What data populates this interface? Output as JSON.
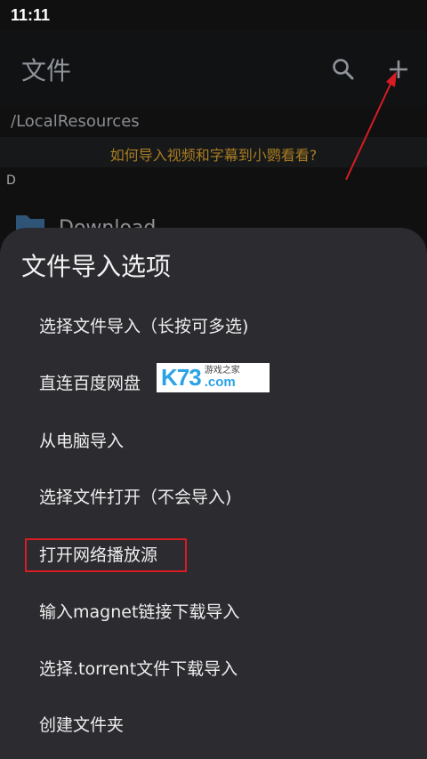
{
  "status_bar": {
    "time": "11:11"
  },
  "app_bar": {
    "title": "文件",
    "actions": [
      {
        "icon": "search-icon"
      },
      {
        "icon": "add-icon"
      }
    ]
  },
  "path": "/LocalResources",
  "tip": "如何导入视频和字幕到小鹦看看?",
  "section_header": "D",
  "folders": [
    {
      "name": "Download"
    }
  ],
  "sheet": {
    "title": "文件导入选项",
    "options": [
      "选择文件导入（长按可多选)",
      "直连百度网盘",
      "从电脑导入",
      "选择文件打开（不会导入)",
      "打开网络播放源",
      "输入magnet链接下载导入",
      "选择.torrent文件下载导入",
      "创建文件夹"
    ]
  },
  "watermark": {
    "logo": "K73",
    "text_cn": "游戏之家",
    "text_com": ".com"
  },
  "colors": {
    "tip": "#a97d22",
    "annotation": "#d71c23",
    "sheet_bg": "#2b2b30"
  }
}
